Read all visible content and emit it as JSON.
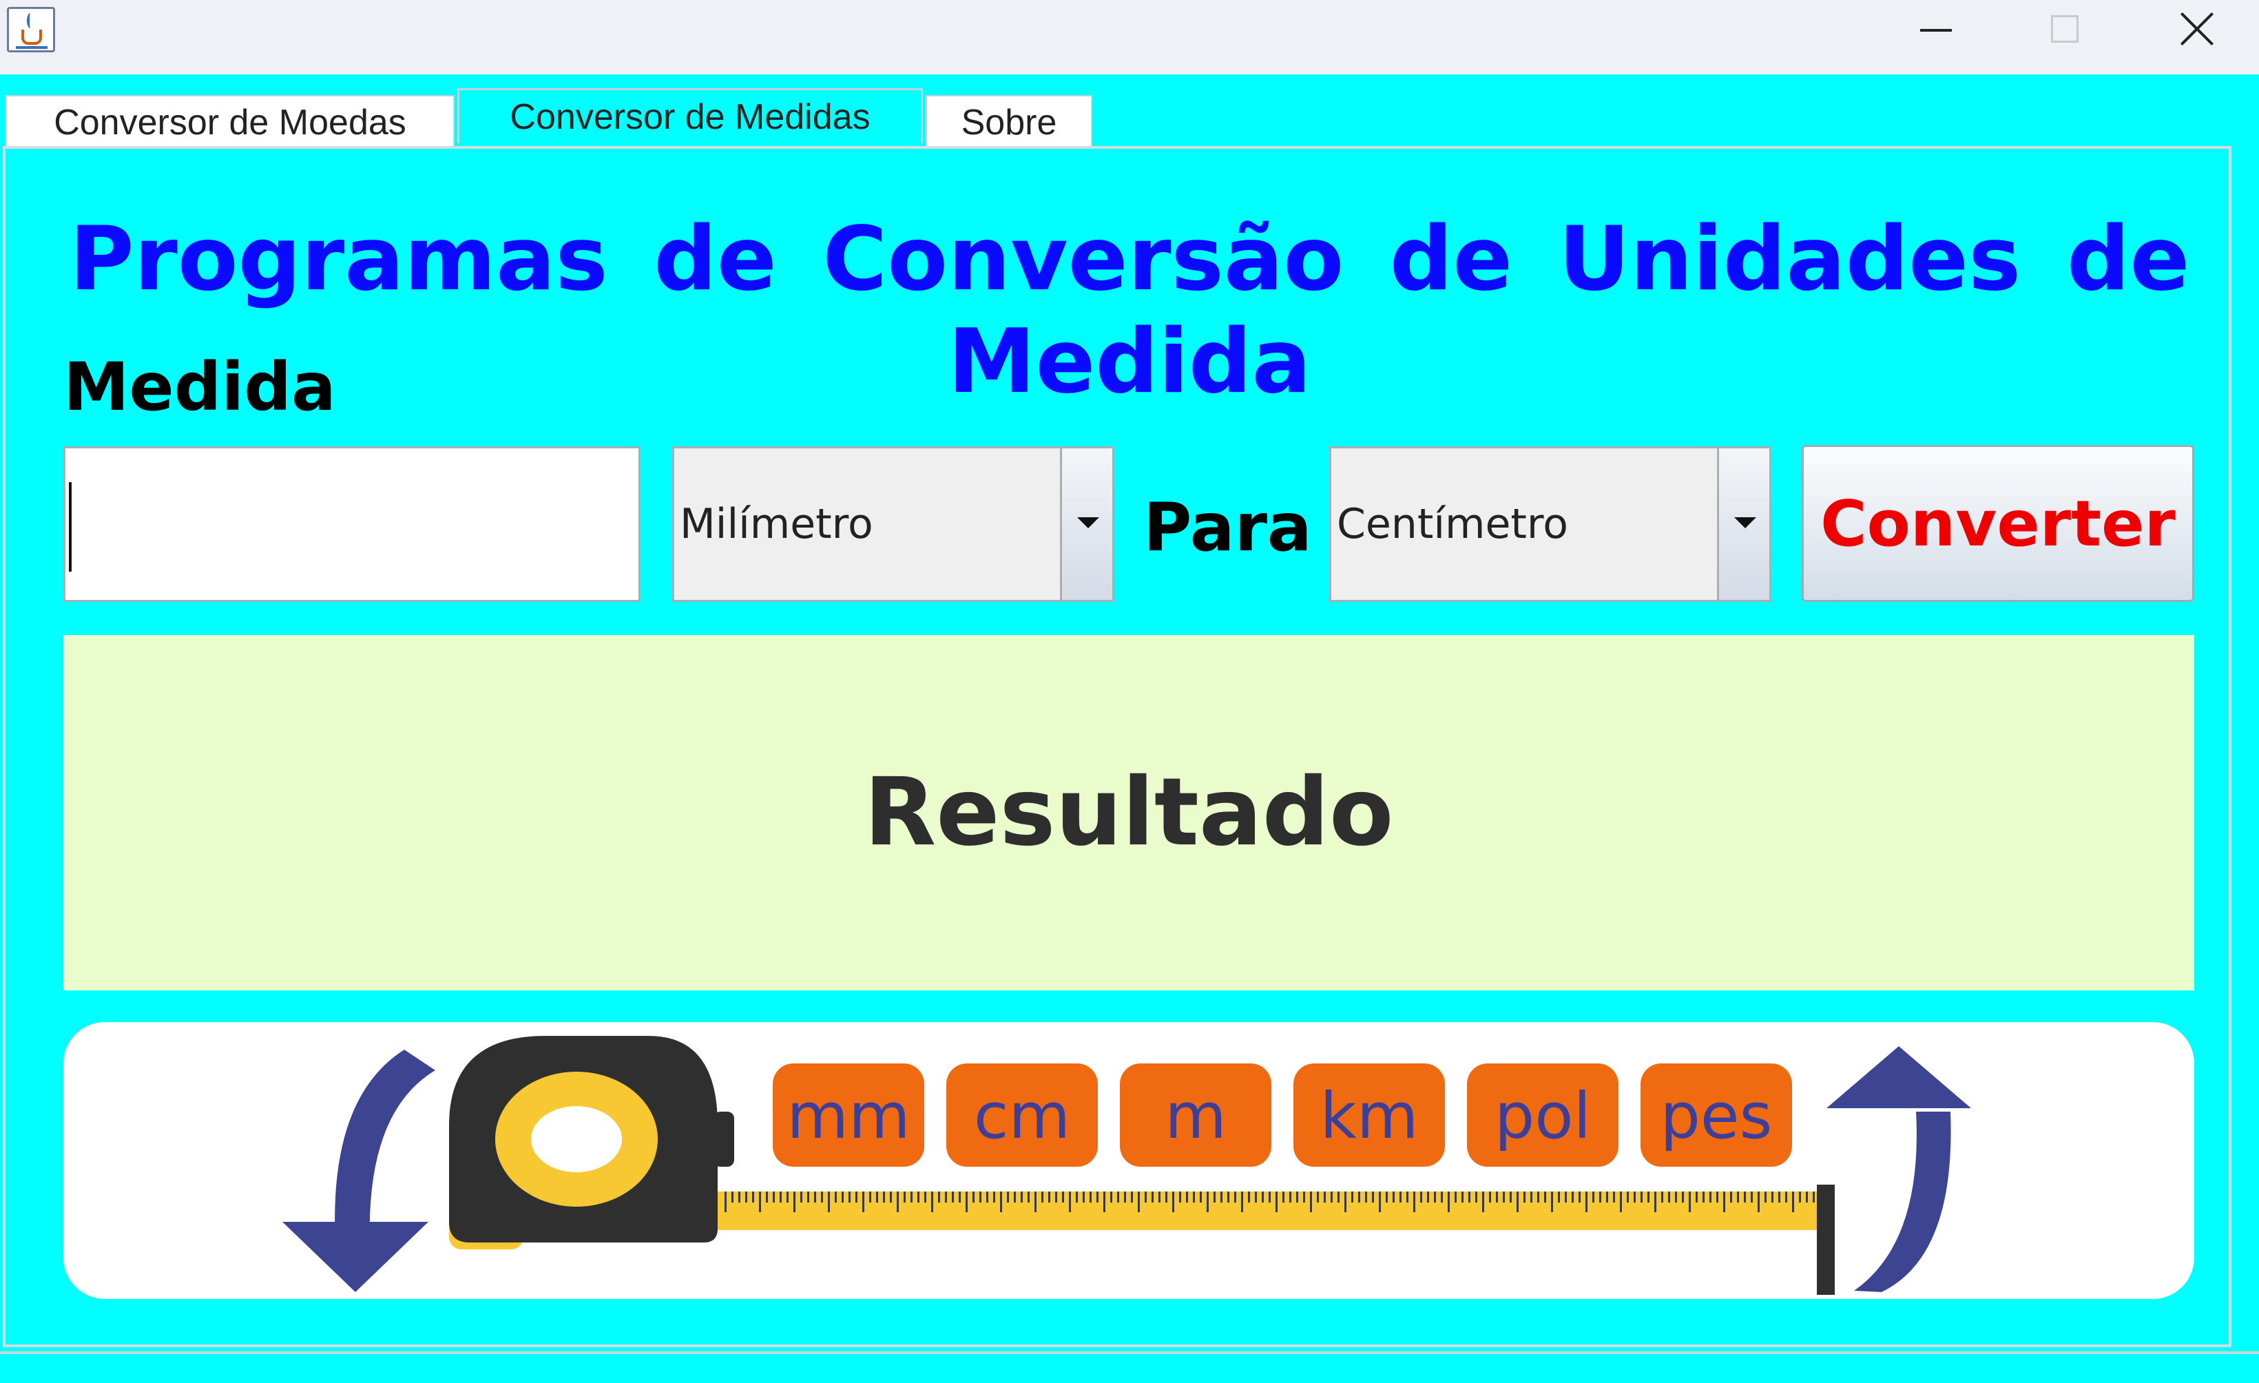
{
  "window": {
    "icons": {
      "app": "java-cup-icon",
      "minimize": "minimize-icon",
      "maximize": "maximize-icon",
      "close": "close-icon"
    }
  },
  "tabs": [
    {
      "label": "Conversor de Moedas",
      "selected": false
    },
    {
      "label": "Conversor de Medidas",
      "selected": true
    },
    {
      "label": "Sobre",
      "selected": false
    }
  ],
  "main": {
    "title": "Programas de Conversão de Unidades de Medida",
    "medida_label": "Medida",
    "medida_value": "",
    "from_unit": "Milímetro",
    "para_label": "Para",
    "to_unit": "Centímetro",
    "convert_label": "Converter",
    "result_label": "Resultado"
  },
  "banner": {
    "units": [
      "mm",
      "cm",
      "m",
      "km",
      "pol",
      "pes"
    ],
    "icons": [
      "arrow-down-icon",
      "tape-measure-icon",
      "arrow-up-icon"
    ]
  },
  "colors": {
    "background": "#00ffff",
    "title": "#0a0aff",
    "convert_text": "#ee0000",
    "result_bg": "#eafccc",
    "unit_chip": "#f06a12",
    "unit_text": "#3b3f9a",
    "arrow": "#3d4593",
    "tape": "#f7c832"
  }
}
